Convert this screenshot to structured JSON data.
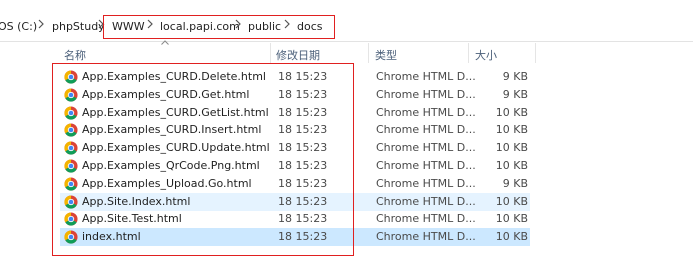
{
  "breadcrumb": {
    "drive": "OS (C:)",
    "items": [
      "phpStudy",
      "WWW",
      "local.papi.com",
      "public",
      "docs"
    ]
  },
  "columns": {
    "name": "名称",
    "modified": "修改日期",
    "type": "类型",
    "size": "大小"
  },
  "files": [
    {
      "name": "App.Examples_CURD.Delete.html",
      "modified": "18 15:23",
      "type": "Chrome HTML D...",
      "size": "9 KB"
    },
    {
      "name": "App.Examples_CURD.Get.html",
      "modified": "18 15:23",
      "type": "Chrome HTML D...",
      "size": "9 KB"
    },
    {
      "name": "App.Examples_CURD.GetList.html",
      "modified": "18 15:23",
      "type": "Chrome HTML D...",
      "size": "10 KB"
    },
    {
      "name": "App.Examples_CURD.Insert.html",
      "modified": "18 15:23",
      "type": "Chrome HTML D...",
      "size": "10 KB"
    },
    {
      "name": "App.Examples_CURD.Update.html",
      "modified": "18 15:23",
      "type": "Chrome HTML D...",
      "size": "10 KB"
    },
    {
      "name": "App.Examples_QrCode.Png.html",
      "modified": "18 15:23",
      "type": "Chrome HTML D...",
      "size": "10 KB"
    },
    {
      "name": "App.Examples_Upload.Go.html",
      "modified": "18 15:23",
      "type": "Chrome HTML D...",
      "size": "9 KB"
    },
    {
      "name": "App.Site.Index.html",
      "modified": "18 15:23",
      "type": "Chrome HTML D...",
      "size": "10 KB"
    },
    {
      "name": "App.Site.Test.html",
      "modified": "18 15:23",
      "type": "Chrome HTML D...",
      "size": "10 KB"
    },
    {
      "name": "index.html",
      "modified": "18 15:23",
      "type": "Chrome HTML D...",
      "size": "10 KB"
    }
  ],
  "icons": {
    "breadcrumb_separator": "chevron-right-icon",
    "file": "chrome-html-file-icon",
    "sort": "sort-ascending-icon"
  },
  "colors": {
    "highlight_box": "#e02020",
    "row_hover": "#e5f3ff",
    "row_selected": "#cce8ff",
    "header_text": "#4c607a"
  }
}
